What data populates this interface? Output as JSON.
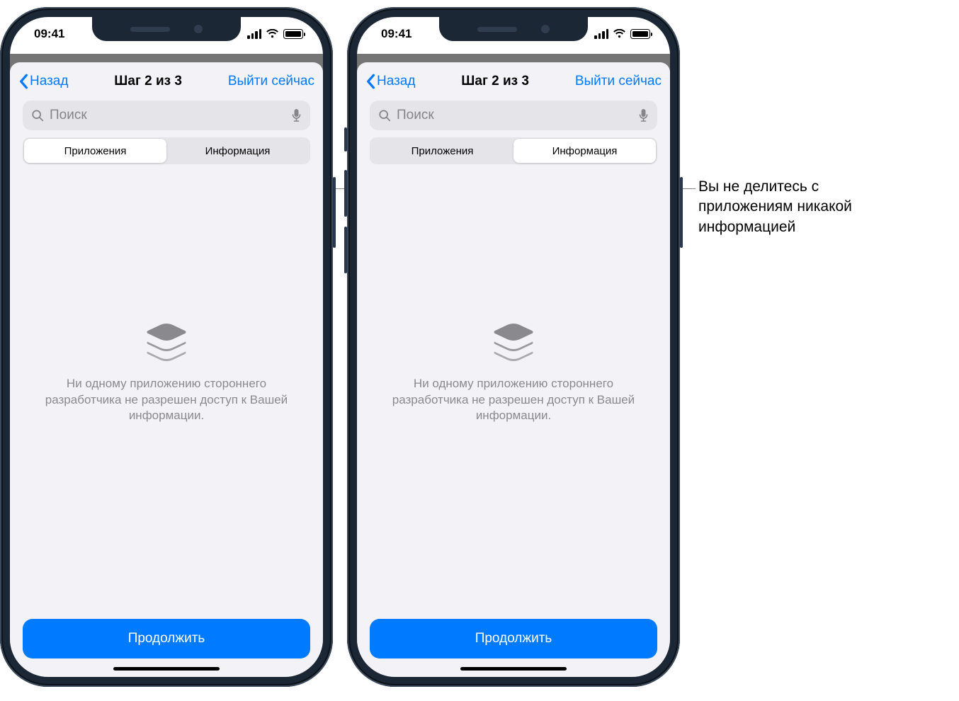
{
  "status": {
    "time": "09:41"
  },
  "nav": {
    "back": "Назад",
    "title": "Шаг 2 из 3",
    "action": "Выйти сейчас"
  },
  "search": {
    "placeholder": "Поиск"
  },
  "segments": {
    "apps": "Приложения",
    "info": "Информация"
  },
  "empty": {
    "text": "Ни одному приложению стороннего разработчика не разрешен доступ к Вашей информации."
  },
  "footer": {
    "continue": "Продолжить"
  },
  "callout": {
    "line1": "Вы не делитесь с",
    "line2": "приложениям никакой",
    "line3": "информацией"
  }
}
